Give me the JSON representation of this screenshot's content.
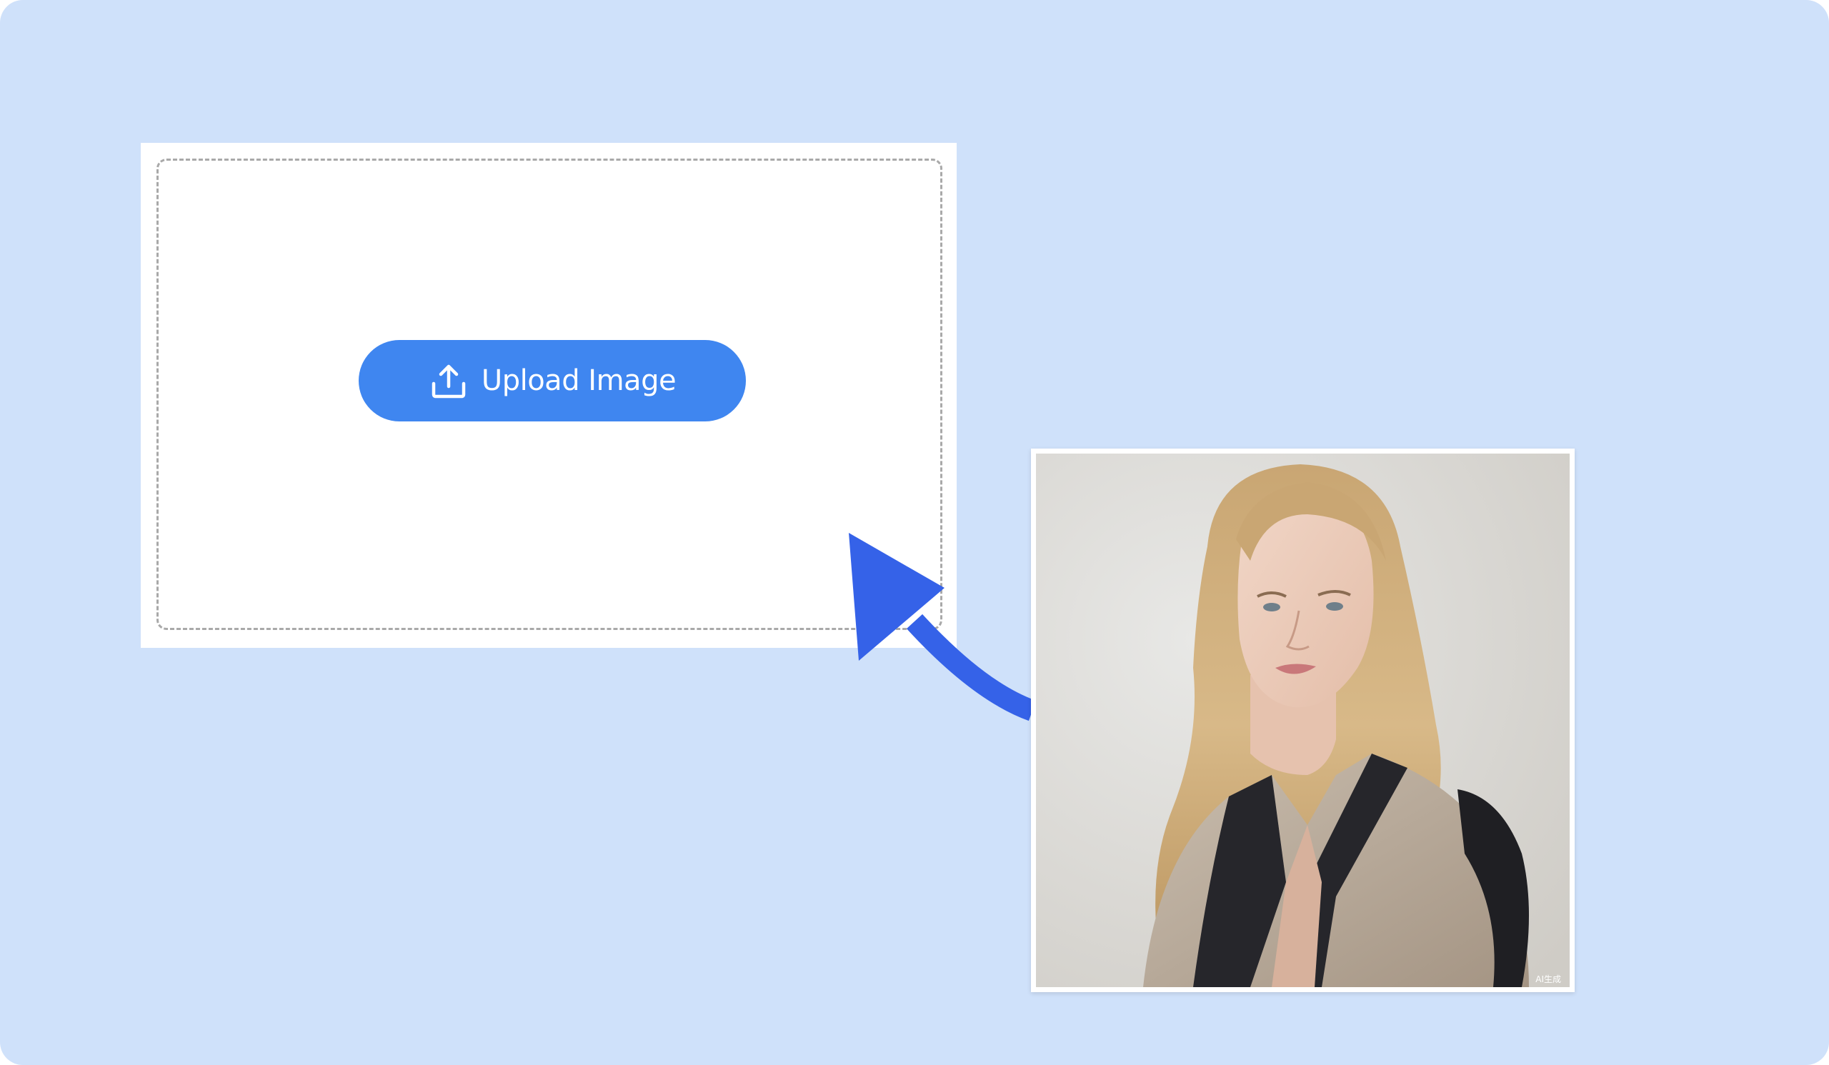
{
  "upload": {
    "button_label": "Upload Image",
    "button_icon": "upload-icon"
  },
  "arrow": {
    "icon": "curved-arrow-icon",
    "color": "#3562e8"
  },
  "photo": {
    "subject": "portrait-photo",
    "watermark": "AI生成"
  },
  "colors": {
    "background": "#cfe1fa",
    "button": "#3f86f0"
  }
}
